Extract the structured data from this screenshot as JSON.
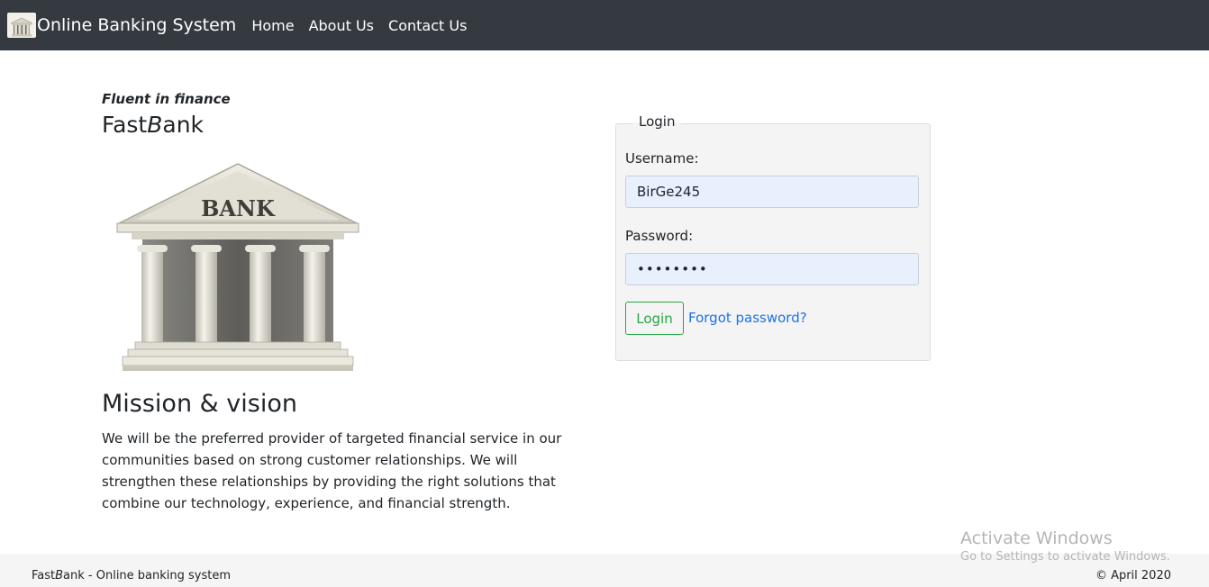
{
  "navbar": {
    "brand_text": "Online Banking System",
    "logo_icon": "bank-building-icon",
    "links": [
      "Home",
      "About Us",
      "Contact Us"
    ]
  },
  "hero": {
    "tagline": "Fluent in finance",
    "bank_name_prefix": "Fast",
    "bank_name_b": "B",
    "bank_name_suffix": "ank",
    "image_sign": "BANK"
  },
  "mission": {
    "title": "Mission & vision",
    "text": "We will be the preferred provider of targeted financial service in our communities based on strong customer relationships. We will strengthen these relationships by providing the right solutions that combine our technology, experience, and financial strength."
  },
  "login": {
    "legend": "Login",
    "username_label": "Username:",
    "username_value": "BirGe245",
    "password_label": "Password:",
    "password_masked": "••••••••",
    "button_label": "Login",
    "forgot_label": "Forgot password?"
  },
  "footer": {
    "left_prefix": "Fast",
    "left_b": "B",
    "left_suffix": "ank - Online banking system",
    "right": "© April 2020"
  },
  "watermark": {
    "title": "Activate Windows",
    "subtitle": "Go to Settings to activate Windows."
  },
  "colors": {
    "navbar_bg": "#343a40",
    "success": "#28a745",
    "link": "#1a73e8",
    "input_autofill_bg": "#e8f0fe"
  }
}
